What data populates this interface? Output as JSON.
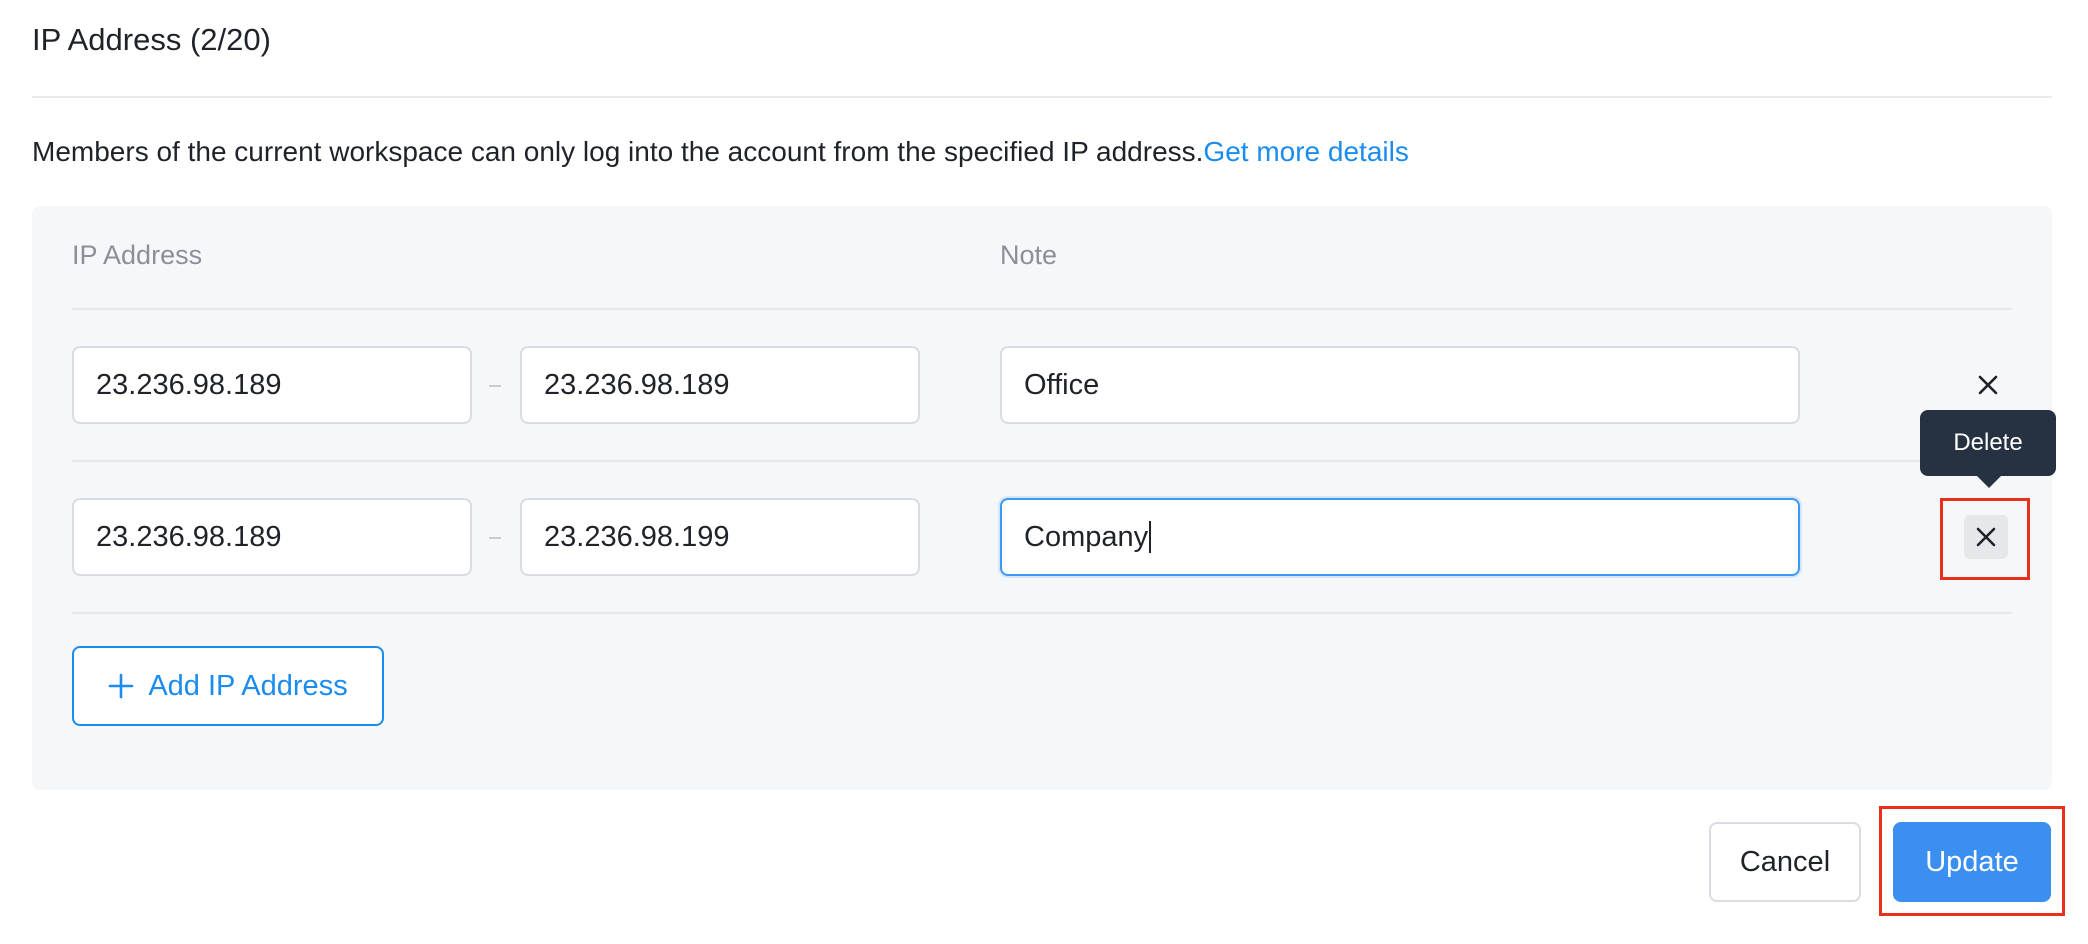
{
  "header": {
    "title": "IP Address (2/20)"
  },
  "description": {
    "text": "Members of the current workspace can only log into the account from the specified IP address.",
    "link_label": "Get more details"
  },
  "table": {
    "col_ip": "IP Address",
    "col_note": "Note",
    "rows": [
      {
        "ip_start": "23.236.98.189",
        "ip_end": "23.236.98.189",
        "note": "Office"
      },
      {
        "ip_start": "23.236.98.189",
        "ip_end": "23.236.98.199",
        "note": "Company"
      }
    ]
  },
  "tooltip": {
    "label": "Delete"
  },
  "add_button": {
    "label": "Add IP Address"
  },
  "footer": {
    "cancel_label": "Cancel",
    "update_label": "Update"
  },
  "colors": {
    "accent": "#1a8cf0",
    "primary_button": "#3b8ff0",
    "highlight": "#e8301c",
    "tooltip_bg": "#263241"
  }
}
